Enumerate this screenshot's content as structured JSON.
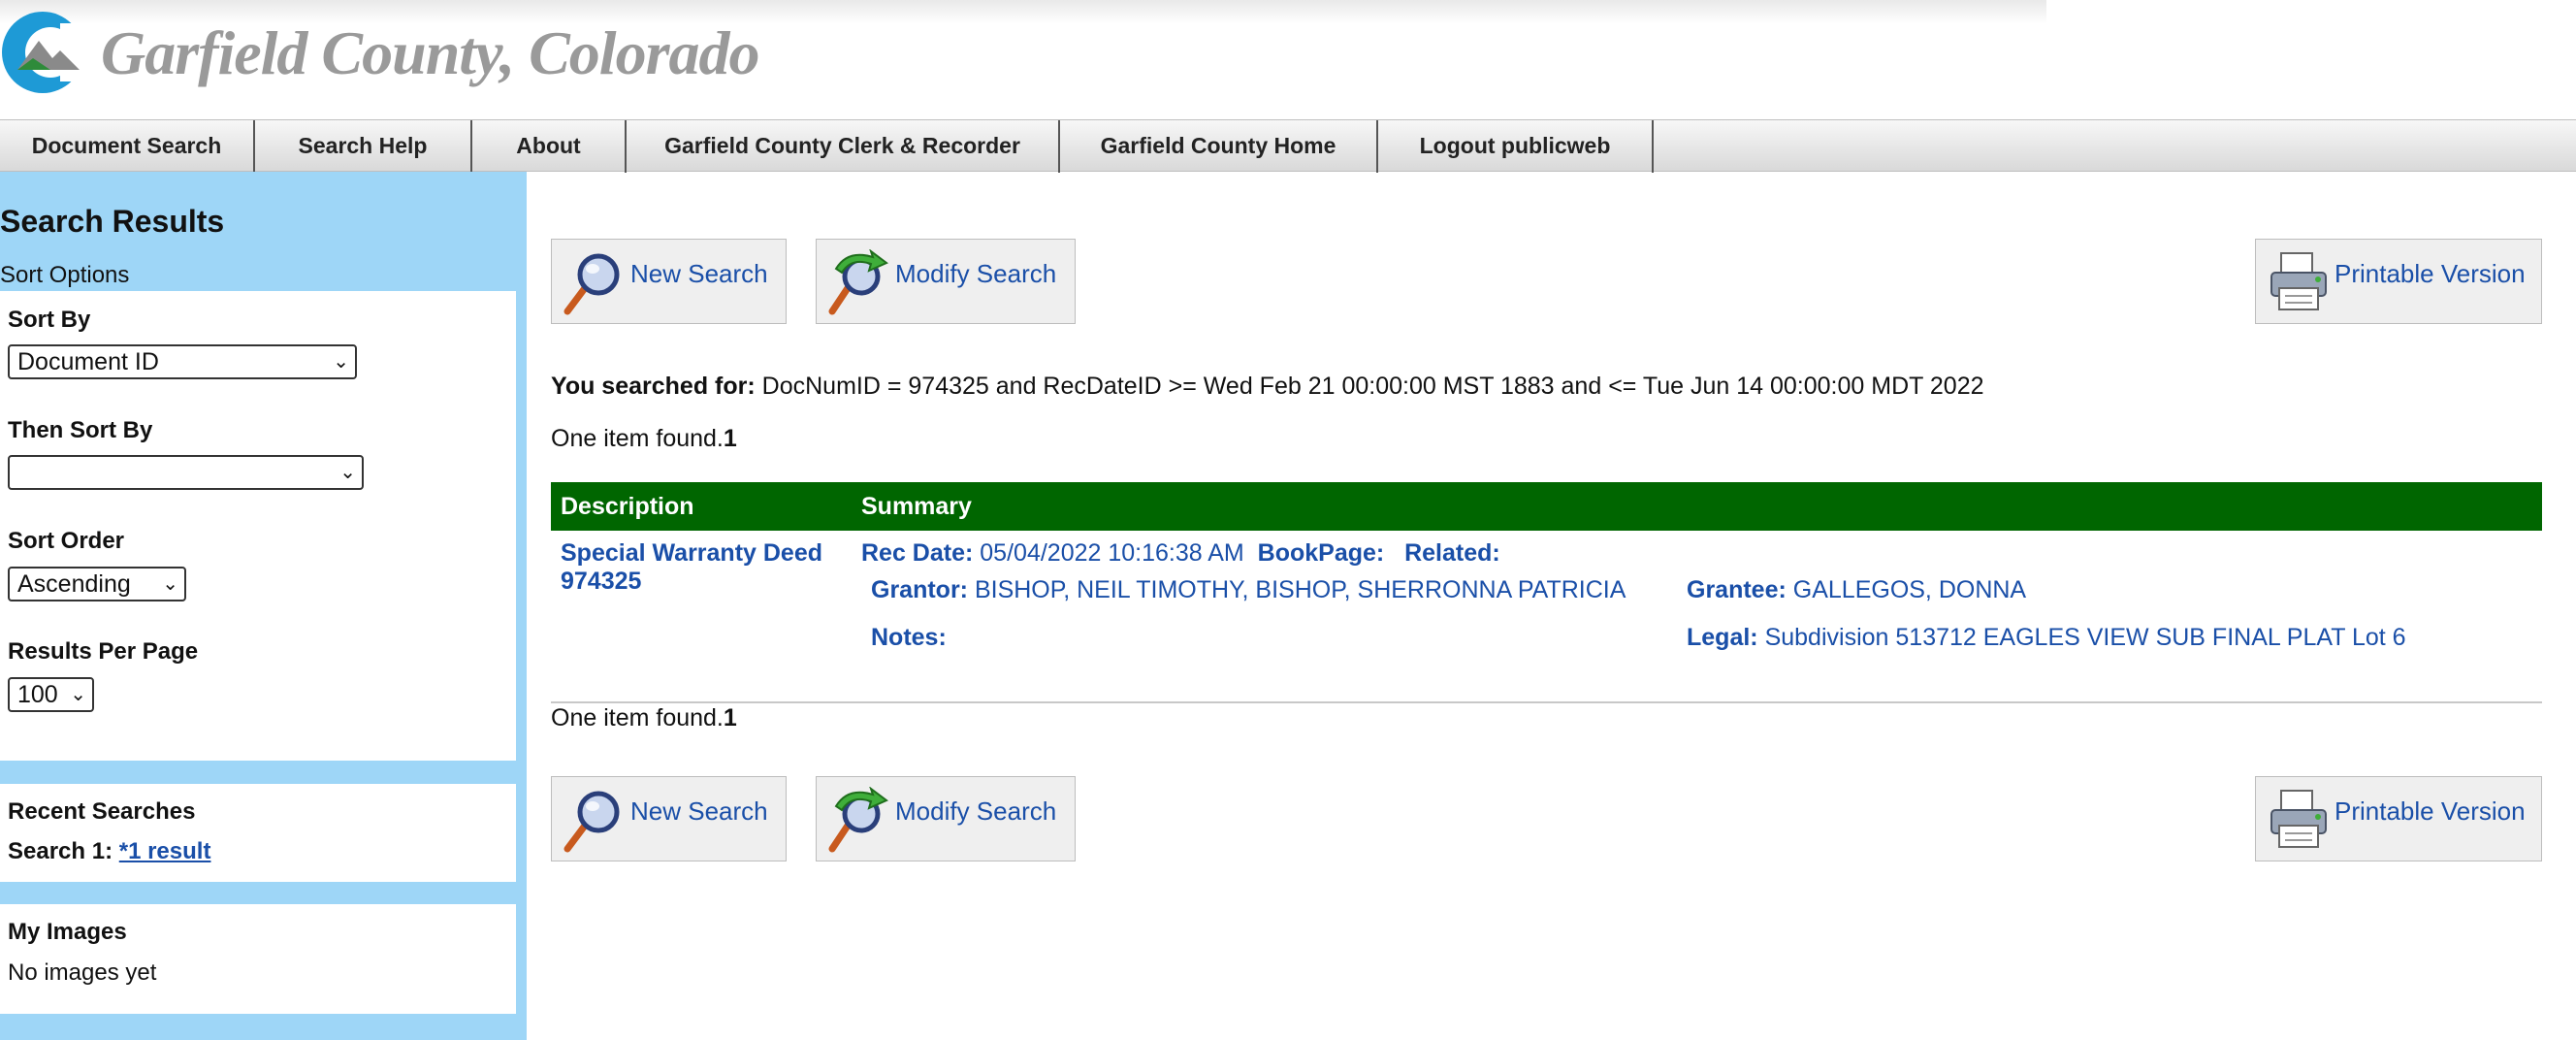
{
  "site": {
    "title": "Garfield County, Colorado"
  },
  "nav": {
    "items": [
      {
        "label": "Document Search"
      },
      {
        "label": "Search Help"
      },
      {
        "label": "About"
      },
      {
        "label": "Garfield County Clerk & Recorder"
      },
      {
        "label": "Garfield County Home"
      },
      {
        "label": "Logout publicweb"
      }
    ]
  },
  "sidebar": {
    "title": "Search Results",
    "sort_options_label": "Sort Options",
    "sort_by_label": "Sort By",
    "sort_by_value": "Document ID",
    "then_sort_by_label": "Then Sort By",
    "then_sort_by_value": "",
    "sort_order_label": "Sort Order",
    "sort_order_value": "Ascending",
    "results_per_page_label": "Results Per Page",
    "results_per_page_value": "100",
    "recent_searches_label": "Recent Searches",
    "recent_search_1_label": "Search 1:",
    "recent_search_1_link": "*1 result",
    "my_images_label": "My Images",
    "my_images_value": "No images yet"
  },
  "buttons": {
    "new_search": "New Search",
    "modify_search": "Modify Search",
    "printable_version": "Printable Version"
  },
  "search": {
    "label": "You searched for:",
    "query": "DocNumID = 974325 and RecDateID >= Wed Feb 21 00:00:00 MST 1883 and <= Tue Jun 14 00:00:00 MDT 2022",
    "found_text": "One item found.",
    "found_count": "1"
  },
  "table": {
    "headers": [
      "Description",
      "Summary"
    ],
    "rows": [
      {
        "doc_type": "Special Warranty Deed",
        "doc_number": "974325",
        "rec_date_label": "Rec Date:",
        "rec_date": "05/04/2022 10:16:38 AM",
        "bookpage_label": "BookPage:",
        "related_label": "Related:",
        "grantor_label": "Grantor:",
        "grantor": "BISHOP, NEIL TIMOTHY, BISHOP, SHERRONNA PATRICIA",
        "grantee_label": "Grantee:",
        "grantee": "GALLEGOS, DONNA",
        "notes_label": "Notes:",
        "legal_label": "Legal:",
        "legal": "Subdivision 513712 EAGLES VIEW SUB FINAL PLAT Lot 6"
      }
    ]
  },
  "colors": {
    "nav_bg": "#e5e5e5",
    "sidebar_bg": "#9ed6f7",
    "table_header": "#006600",
    "link": "#1a4fa8"
  },
  "icons": [
    "logo",
    "magnifier-icon",
    "modify-search-icon",
    "printer-icon",
    "chevron-down-icon"
  ]
}
